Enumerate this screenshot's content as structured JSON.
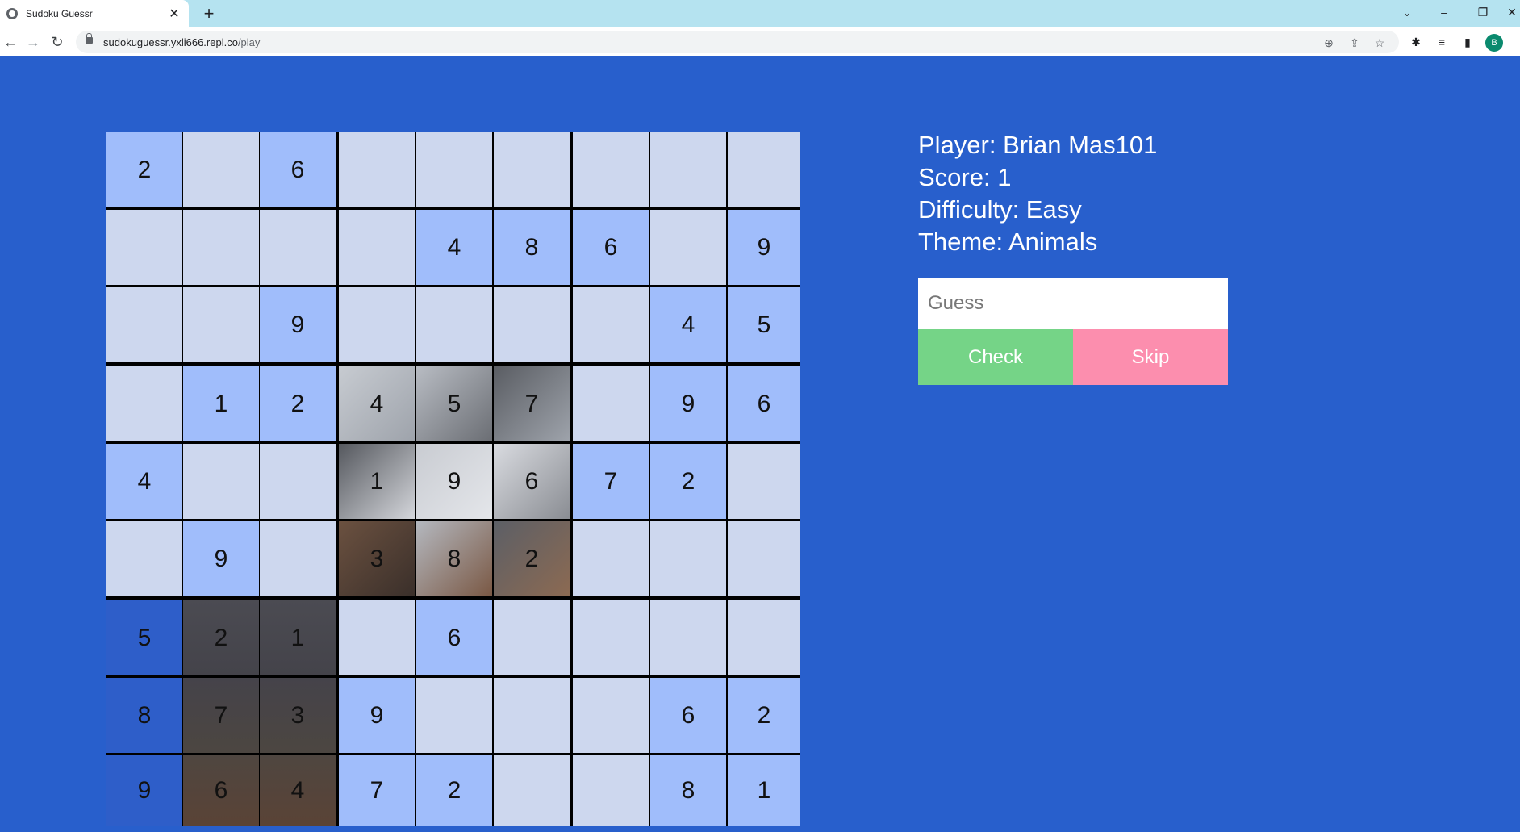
{
  "browser": {
    "tab_title": "Sudoku Guessr",
    "url_host": "sudokuguessr.yxli666.repl.co",
    "url_path": "/play",
    "profile_initial": "B"
  },
  "player": {
    "player_line": "Player: Brian Mas101",
    "score_line": "Score: 1",
    "difficulty_line": "Difficulty: Easy",
    "theme_line": "Theme: Animals"
  },
  "guess": {
    "placeholder": "Guess",
    "check_label": "Check",
    "skip_label": "Skip"
  },
  "board": {
    "rows": [
      [
        "2",
        "",
        "6",
        "",
        "",
        "",
        "",
        "",
        ""
      ],
      [
        "",
        "",
        "",
        "",
        "4",
        "8",
        "6",
        "",
        "9"
      ],
      [
        "",
        "",
        "9",
        "",
        "",
        "",
        "",
        "4",
        "5"
      ],
      [
        "",
        "1",
        "2",
        "4",
        "5",
        "7",
        "",
        "9",
        "6"
      ],
      [
        "4",
        "",
        "",
        "1",
        "9",
        "6",
        "7",
        "2",
        ""
      ],
      [
        "",
        "9",
        "",
        "3",
        "8",
        "2",
        "",
        "",
        ""
      ],
      [
        "5",
        "2",
        "1",
        "",
        "6",
        "",
        "",
        "",
        ""
      ],
      [
        "8",
        "7",
        "3",
        "9",
        "",
        "",
        "",
        "6",
        "2"
      ],
      [
        "9",
        "6",
        "4",
        "7",
        "2",
        "",
        "",
        "8",
        "1"
      ]
    ],
    "cell_types": [
      [
        "f",
        "e",
        "f",
        "e",
        "e",
        "e",
        "e",
        "e",
        "e"
      ],
      [
        "e",
        "e",
        "e",
        "e",
        "f",
        "f",
        "f",
        "e",
        "f"
      ],
      [
        "e",
        "e",
        "f",
        "e",
        "e",
        "e",
        "e",
        "f",
        "f"
      ],
      [
        "e",
        "f",
        "f",
        "i",
        "i",
        "i",
        "e",
        "f",
        "f"
      ],
      [
        "f",
        "e",
        "e",
        "i",
        "i",
        "i",
        "f",
        "f",
        "e"
      ],
      [
        "e",
        "f",
        "e",
        "i",
        "i",
        "i",
        "e",
        "e",
        "e"
      ],
      [
        "d",
        "p",
        "p",
        "e",
        "f",
        "e",
        "e",
        "e",
        "e"
      ],
      [
        "d",
        "p",
        "p",
        "f",
        "e",
        "e",
        "e",
        "f",
        "f"
      ],
      [
        "d",
        "p",
        "p",
        "f",
        "f",
        "e",
        "e",
        "f",
        "f"
      ]
    ],
    "colors": {
      "empty": "#cdd7ee",
      "filled": "#a0bdfb",
      "revealed_blue": "#2e5ec9"
    }
  }
}
